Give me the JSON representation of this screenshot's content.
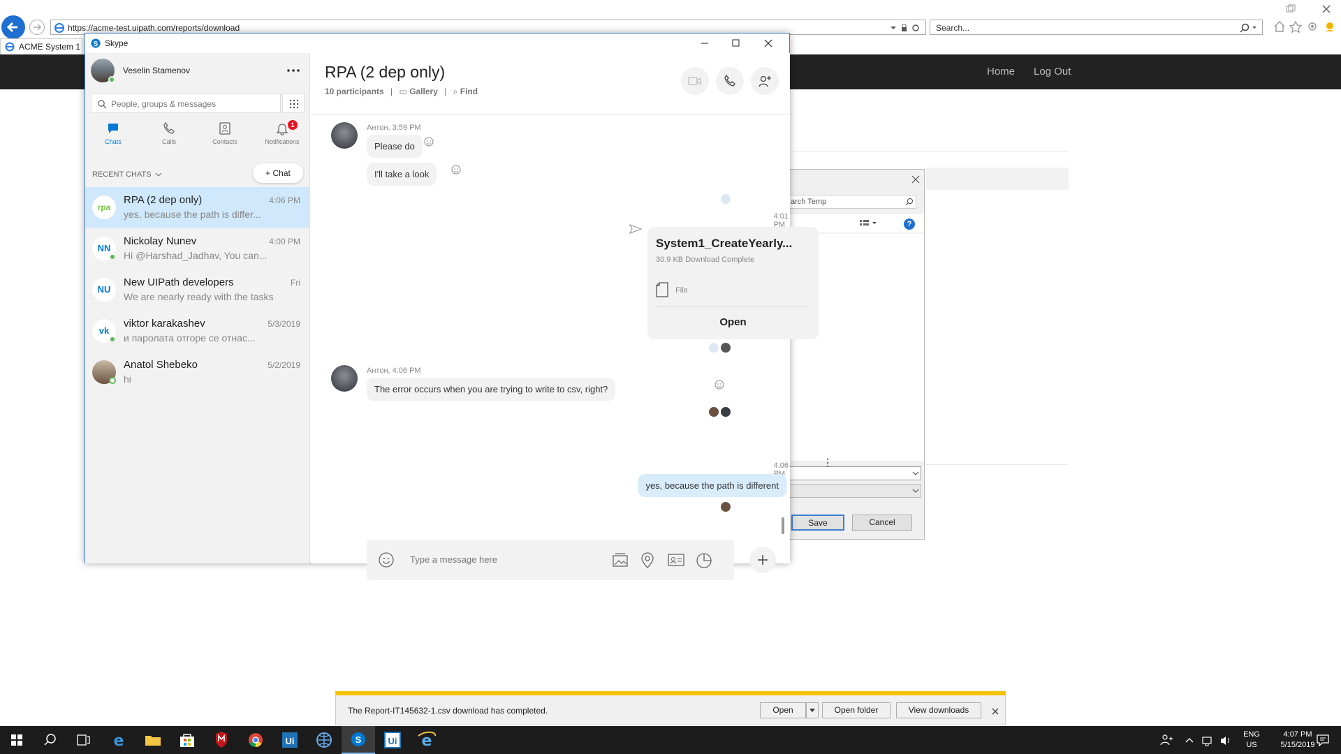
{
  "browser": {
    "url": "https://acme-test.uipath.com/reports/download",
    "search_placeholder": "Search...",
    "tab_title": "ACME System 1 -"
  },
  "site": {
    "nav": [
      "Home",
      "Log Out"
    ]
  },
  "save_dialog": {
    "search_placeholder": "arch Temp",
    "save_label": "Save",
    "cancel_label": "Cancel"
  },
  "skype": {
    "window_title": "Skype",
    "user_name": "Veselin Stamenov",
    "search_placeholder": "People, groups & messages",
    "nav": [
      {
        "label": "Chats",
        "icon": "chat-icon"
      },
      {
        "label": "Calls",
        "icon": "phone-icon"
      },
      {
        "label": "Contacts",
        "icon": "contacts-icon"
      },
      {
        "label": "Notifications",
        "icon": "bell-icon",
        "badge": "1"
      }
    ],
    "recent_label": "RECENT CHATS",
    "new_chat_label": "Chat",
    "chats": [
      {
        "name": "RPA (2 dep only)",
        "preview": "yes, because the path is differ...",
        "time": "4:06 PM",
        "avatar": "rpa",
        "active": true
      },
      {
        "name": "Nickolay Nunev",
        "preview": "Hi @Harshad_Jadhav, You can...",
        "time": "4:00 PM",
        "avatar": "NN"
      },
      {
        "name": "New UIPath developers",
        "preview": "We are nearly ready with the tasks ...",
        "time": "Fri",
        "avatar": "NU"
      },
      {
        "name": "viktor karakashev",
        "preview": "и паролата отгоре се отнас...",
        "time": "5/3/2019",
        "avatar": "vk"
      },
      {
        "name": "Anatol Shebeko",
        "preview": "hi",
        "time": "5/2/2019",
        "avatar": "photo"
      }
    ],
    "conversation": {
      "title": "RPA (2 dep only)",
      "participants": "10 participants",
      "gallery": "Gallery",
      "find": "Find",
      "messages": {
        "meta1": "Антон, 3:59 PM",
        "m1": "Please do",
        "m2": "I'll take a look",
        "file_time": "4:01 PM",
        "file_name": "System1_CreateYearly...",
        "file_status": "30.9 KB Download Complete",
        "file_type": "File",
        "file_open": "Open",
        "meta2": "Антон, 4:06 PM",
        "m3": "The error occurs when you are trying to write to csv, right?",
        "my_time": "4:06 PM",
        "m4": "yes, because the path is different"
      },
      "compose_placeholder": "Type a message here"
    }
  },
  "download_bar": {
    "message": "The Report-IT145632-1.csv download has completed.",
    "open": "Open",
    "open_folder": "Open folder",
    "view_downloads": "View downloads"
  },
  "taskbar": {
    "lang": "ENG",
    "region": "US",
    "time": "4:07 PM",
    "date": "5/15/2019"
  },
  "colors": {
    "skype_blue": "#0078d4",
    "active_chat": "#cfe8fb",
    "site_nav": "#222222",
    "download_accent": "#f3c200"
  }
}
